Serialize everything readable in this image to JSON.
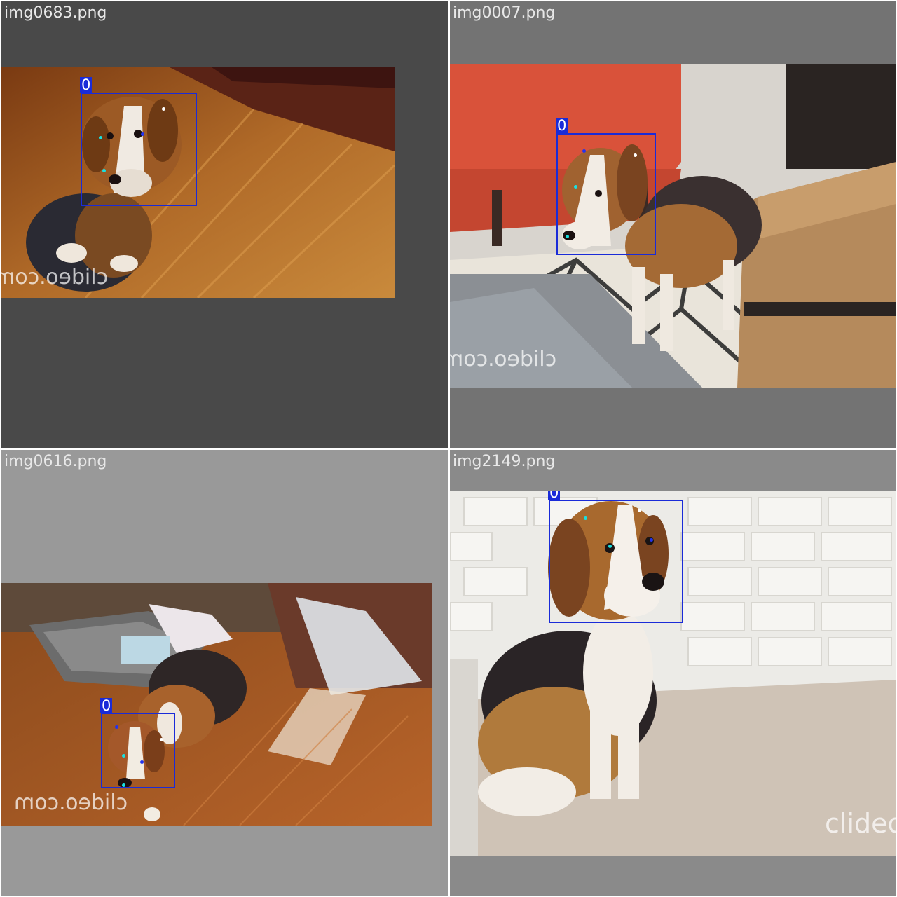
{
  "tiles": [
    {
      "filename": "img0683.png",
      "class_id": "0",
      "watermark": "clideo.com",
      "background": "#494949"
    },
    {
      "filename": "img0007.png",
      "class_id": "0",
      "watermark": "clideo.com",
      "background": "#737373"
    },
    {
      "filename": "img0616.png",
      "class_id": "0",
      "watermark": "clideo.com",
      "background": "#999999"
    },
    {
      "filename": "img2149.png",
      "class_id": "0",
      "watermark": "clideo",
      "background": "#8a8a8a"
    }
  ],
  "colors": {
    "box": "#1a2bd8",
    "keypoint_cyan": "#19e0e0",
    "keypoint_blue": "#2233ee",
    "keypoint_white": "#ffffff"
  }
}
